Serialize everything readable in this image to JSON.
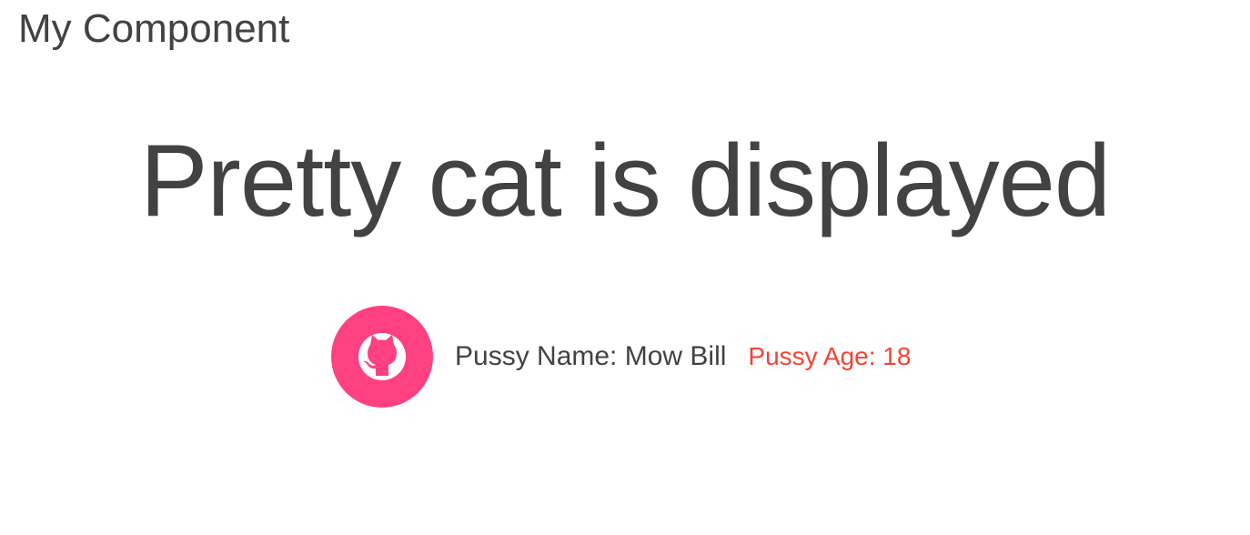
{
  "component": {
    "title": "My Component"
  },
  "hero": {
    "heading": "Pretty cat is displayed"
  },
  "cat": {
    "avatar_icon": "github-octocat-icon",
    "avatar_color": "#ff4081",
    "name_text": "Pussy Name: Mow Bill",
    "age_text": "Pussy Age: 18",
    "age_color": "#f44336"
  }
}
